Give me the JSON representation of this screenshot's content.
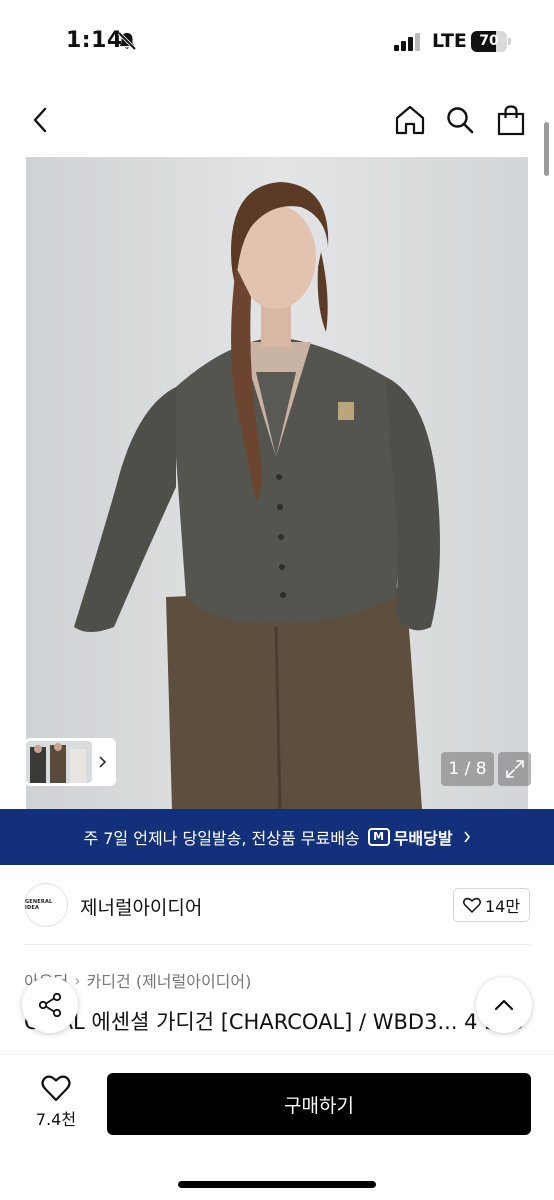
{
  "status_bar": {
    "time": "1:14",
    "network": "LTE",
    "battery": "70",
    "battery_level": 0.7
  },
  "nav": {
    "back_icon": "chevron-left-icon",
    "home_icon": "home-icon",
    "search_icon": "search-icon",
    "bag_icon": "shopping-bag-icon"
  },
  "gallery": {
    "counter": "1 / 8",
    "current_index": 1,
    "total": 8
  },
  "banner": {
    "text": "주 7일 언제나 당일발송, 전상품 무료배송",
    "logo_mark": "M",
    "logo_text": "무배당발",
    "color": "#13307a"
  },
  "store": {
    "logo_text": "GENERAL IDEA",
    "name": "제너럴아이디어",
    "likes": "14만"
  },
  "product": {
    "breadcrumb": [
      "아우터",
      "카디건 (제너럴아이디어)"
    ],
    "title": "C...AL 에센셜 가디건 [CHARCOAL] / WBD3... 4 503"
  },
  "bottom_bar": {
    "wish_count": "7.4천",
    "buy_label": "구매하기"
  }
}
